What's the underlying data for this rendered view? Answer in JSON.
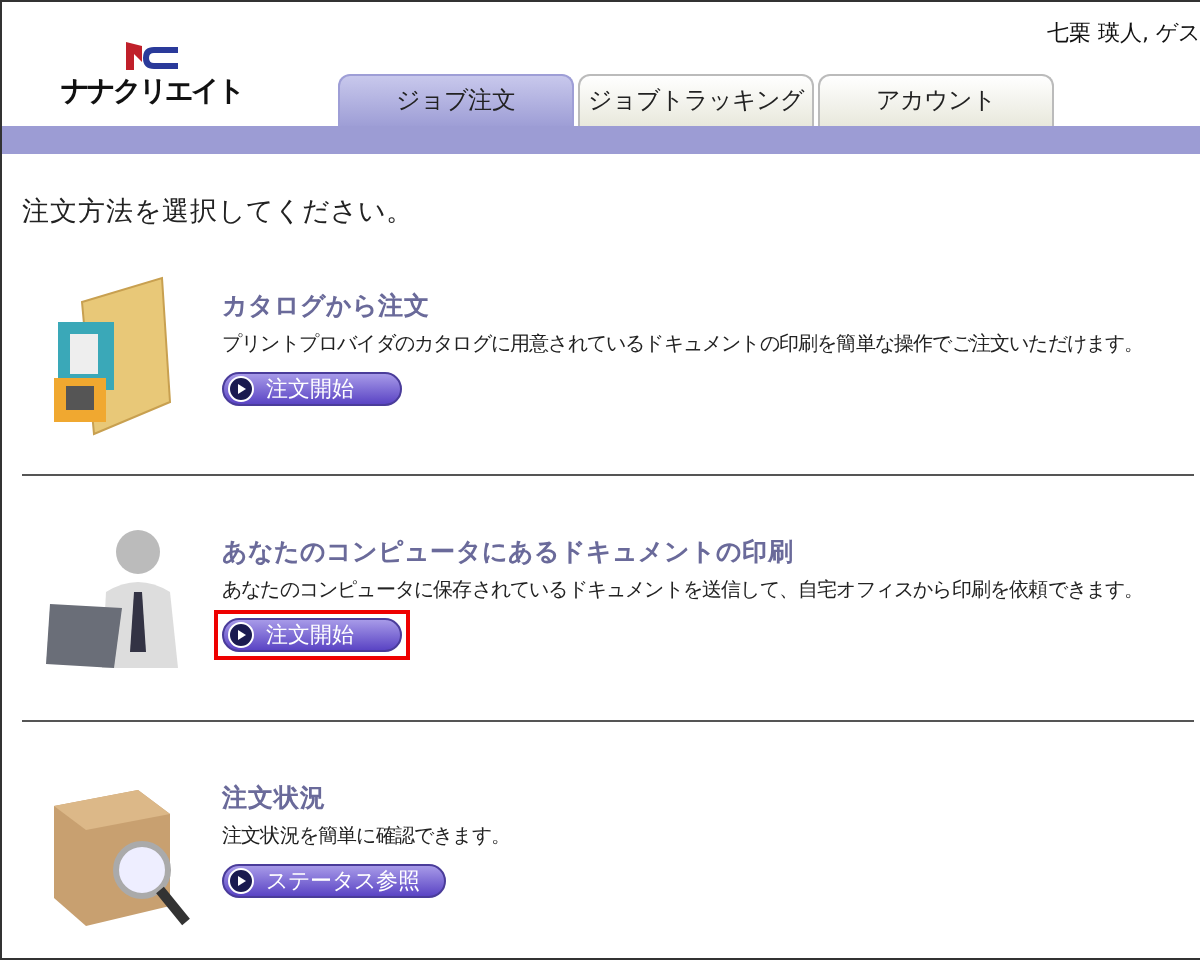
{
  "header": {
    "logo_text": "ナナクリエイト",
    "user": "七栗 瑛人, ゲス"
  },
  "tabs": [
    {
      "label": "ジョブ注文",
      "selected": true
    },
    {
      "label": "ジョブトラッキング",
      "selected": false
    },
    {
      "label": "アカウント",
      "selected": false
    }
  ],
  "heading": "注文方法を選択してください。",
  "sections": [
    {
      "kind": "catalog",
      "title": "カタログから注文",
      "description": "プリントプロバイダのカタログに用意されているドキュメントの印刷を簡単な操作でご注文いただけます。",
      "button": {
        "label": "注文開始",
        "highlighted": false
      }
    },
    {
      "kind": "upload",
      "title": "あなたのコンピュータにあるドキュメントの印刷",
      "description": "あなたのコンピュータに保存されているドキュメントを送信して、自宅オフィスから印刷を依頼できます。",
      "button": {
        "label": "注文開始",
        "highlighted": true
      }
    },
    {
      "kind": "status",
      "title": "注文状況",
      "description": "注文状況を簡単に確認できます。",
      "button": {
        "label": "ステータス参照",
        "highlighted": false
      }
    }
  ]
}
